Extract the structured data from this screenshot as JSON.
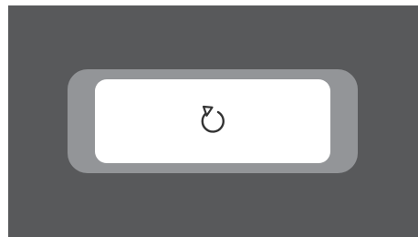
{
  "window": {
    "background_color": "#58595b"
  },
  "reset_button": {
    "icon": "reload-icon",
    "frame_color": "#939598",
    "face_color": "#ffffff",
    "icon_color": "#333333"
  }
}
